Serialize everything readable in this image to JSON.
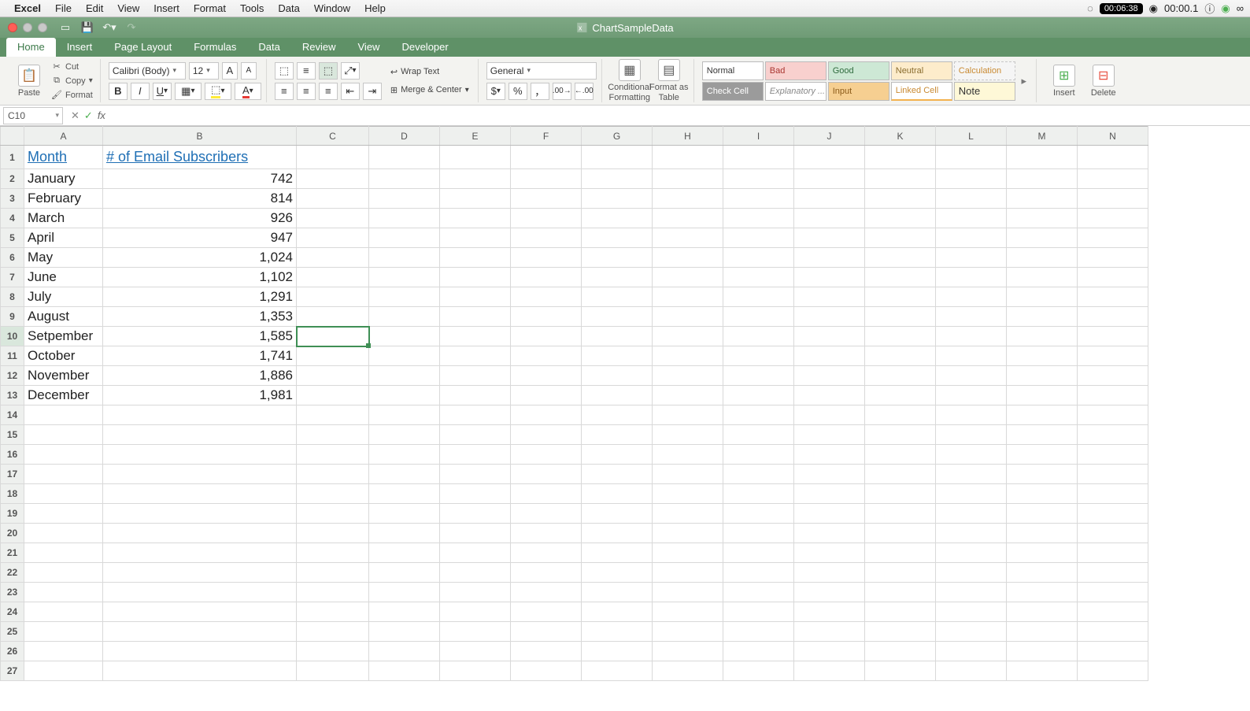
{
  "mac_menu": {
    "app": "Excel",
    "items": [
      "File",
      "Edit",
      "View",
      "Insert",
      "Format",
      "Tools",
      "Data",
      "Window",
      "Help"
    ],
    "timer1": "00:06:38",
    "timer2": "00:00.1"
  },
  "titlebar": {
    "doc_name": "ChartSampleData"
  },
  "ribbon_tabs": [
    "Home",
    "Insert",
    "Page Layout",
    "Formulas",
    "Data",
    "Review",
    "View",
    "Developer"
  ],
  "ribbon_active_tab": "Home",
  "clipboard": {
    "paste": "Paste",
    "cut": "Cut",
    "copy": "Copy",
    "format": "Format"
  },
  "font": {
    "name": "Calibri (Body)",
    "size": "12",
    "increase": "A",
    "decrease": "A"
  },
  "alignment": {
    "wrap": "Wrap Text",
    "merge": "Merge & Center"
  },
  "number": {
    "format": "General"
  },
  "cond": {
    "cf": "Conditional Formatting",
    "fat": "Format as Table"
  },
  "styles": {
    "normal": "Normal",
    "bad": "Bad",
    "good": "Good",
    "neutral": "Neutral",
    "calc": "Calculation",
    "check": "Check Cell",
    "expl": "Explanatory ...",
    "input": "Input",
    "linked": "Linked Cell",
    "note": "Note"
  },
  "cells": {
    "insert": "Insert",
    "delete": "Delete"
  },
  "formula_bar": {
    "namebox": "C10",
    "fx": "fx",
    "formula": ""
  },
  "columns": [
    "A",
    "B",
    "C",
    "D",
    "E",
    "F",
    "G",
    "H",
    "I",
    "J",
    "K",
    "L",
    "M",
    "N"
  ],
  "selected_cell": "C10",
  "selected_col": "C",
  "selected_row": "10",
  "headers": {
    "A": "Month",
    "B": "# of Email Subscribers"
  },
  "rows": [
    {
      "n": "1",
      "A": "Month",
      "B": "# of Email Subscribers",
      "hdr": true
    },
    {
      "n": "2",
      "A": "January",
      "B": "742"
    },
    {
      "n": "3",
      "A": "February",
      "B": "814"
    },
    {
      "n": "4",
      "A": "March",
      "B": "926"
    },
    {
      "n": "5",
      "A": "April",
      "B": "947"
    },
    {
      "n": "6",
      "A": "May",
      "B": "1,024"
    },
    {
      "n": "7",
      "A": "June",
      "B": "1,102"
    },
    {
      "n": "8",
      "A": "July",
      "B": "1,291"
    },
    {
      "n": "9",
      "A": "August",
      "B": "1,353"
    },
    {
      "n": "10",
      "A": "Setpember",
      "B": "1,585"
    },
    {
      "n": "11",
      "A": "October",
      "B": "1,741"
    },
    {
      "n": "12",
      "A": "November",
      "B": "1,886"
    },
    {
      "n": "13",
      "A": "December",
      "B": "1,981"
    },
    {
      "n": "14"
    },
    {
      "n": "15"
    },
    {
      "n": "16"
    },
    {
      "n": "17"
    },
    {
      "n": "18"
    },
    {
      "n": "19"
    },
    {
      "n": "20"
    },
    {
      "n": "21"
    },
    {
      "n": "22"
    },
    {
      "n": "23"
    },
    {
      "n": "24"
    },
    {
      "n": "25"
    },
    {
      "n": "26"
    },
    {
      "n": "27"
    }
  ],
  "chart_data": {
    "type": "table",
    "title": "# of Email Subscribers",
    "categories": [
      "January",
      "February",
      "March",
      "April",
      "May",
      "June",
      "July",
      "August",
      "Setpember",
      "October",
      "November",
      "December"
    ],
    "values": [
      742,
      814,
      926,
      947,
      1024,
      1102,
      1291,
      1353,
      1585,
      1741,
      1886,
      1981
    ],
    "xlabel": "Month",
    "ylabel": "# of Email Subscribers"
  }
}
